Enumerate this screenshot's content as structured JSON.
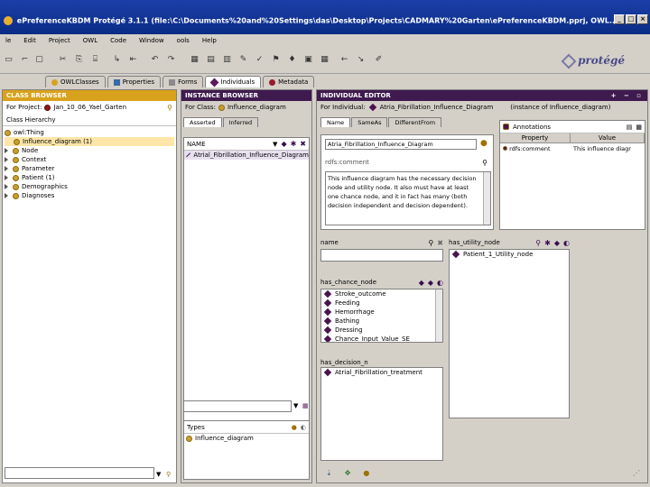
{
  "window": {
    "title": "ePreferenceKBDM  Protégé 3.1.1    (file:\\C:\\Documents%20and%20Settings\\das\\Desktop\\Projects\\CADMARY%20Garten\\ePreferenceKBDM.pprj, OWL..."
  },
  "menu": [
    "le",
    "Edit",
    "Project",
    "OWL",
    "Code",
    "Window",
    "ools",
    "Help"
  ],
  "logo_text": "protégé",
  "tabs": [
    {
      "label": "OWLClasses",
      "color": "#d9a21c"
    },
    {
      "label": "Properties",
      "color": "#3a6aa8"
    },
    {
      "label": "Forms",
      "color": "#8a8a8a"
    },
    {
      "label": "Individuals",
      "color": "#5a1a5a"
    },
    {
      "label": "Metadata",
      "color": "#9a1a2a"
    }
  ],
  "class_browser": {
    "header": "CLASS BROWSER",
    "for_project_label": "For Project:",
    "project": "Jan_10_06_Yael_Garten",
    "hierarchy_label": "Class Hierarchy",
    "items": [
      {
        "label": "owl:Thing",
        "level": 0,
        "expander": false
      },
      {
        "label": "Influence_diagram  (1)",
        "level": 1,
        "expander": false,
        "selected": true
      },
      {
        "label": "Node",
        "level": 1,
        "expander": true
      },
      {
        "label": "Context",
        "level": 1,
        "expander": true
      },
      {
        "label": "Parameter",
        "level": 1,
        "expander": true
      },
      {
        "label": "Patient  (1)",
        "level": 1,
        "expander": true
      },
      {
        "label": "Demographics",
        "level": 1,
        "expander": true
      },
      {
        "label": "Diagnoses",
        "level": 1,
        "expander": true
      }
    ]
  },
  "instance_browser": {
    "header": "INSTANCE BROWSER",
    "for_class_label": "For Class:",
    "class_name": "Influence_diagram",
    "subtabs": [
      "Asserted",
      "Inferred"
    ],
    "name_header": "NAME",
    "instances": [
      "Atrial_Fibrillation_Influence_Diagram"
    ],
    "types_label": "Types",
    "types": [
      "Influence_diagram"
    ]
  },
  "individual_editor": {
    "header": "INDIVIDUAL EDITOR",
    "for_individual_label": "For Individual:",
    "individual_name": "Atria_Fibrillation_Influence_Diagram",
    "instance_of": "(instance of Influence_diagram)",
    "subtabs": [
      "Name",
      "SameAs",
      "DifferentFrom"
    ],
    "name_value": "Atria_Fibrillation_Influence_Diagram",
    "rdfs_comment_label": "rdfs:comment",
    "comment_text": "This influence diagram has the necessary decision node and utility node. It also must have at least one chance node, and it in fact has many (both decision independent and decision dependent).",
    "annotations_label": "Annotations",
    "annotations_columns": [
      "Property",
      "Value"
    ],
    "annotations_rows": [
      {
        "property": "rdfs:comment",
        "value": "This influence diagr"
      }
    ],
    "name_label": "name",
    "has_utility_node_label": "has_utility_node",
    "utility_nodes": [
      "Patient_1_Utility_node"
    ],
    "has_chance_node_label": "has_chance_node",
    "chance_nodes": [
      "Stroke_outcome",
      "Feeding",
      "Hemorrhage",
      "Bathing",
      "Dressing",
      "Chance_Input_Value_SE"
    ],
    "has_decision_node_label": "has_decision_n",
    "decision_nodes": [
      "Atrial_Fibrillation_treatment"
    ]
  }
}
